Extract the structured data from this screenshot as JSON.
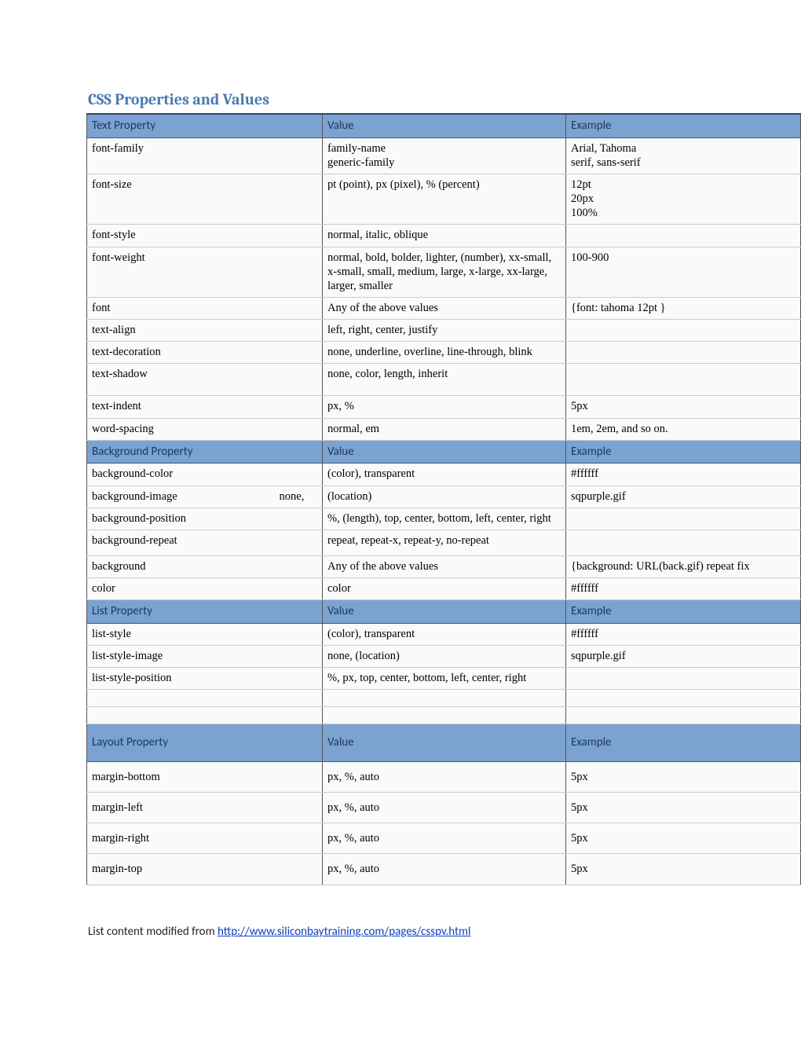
{
  "title": "CSS Properties and Values",
  "columns": {
    "c1": "Text Property",
    "c2": "Value",
    "c3": "Example"
  },
  "section1": {
    "h1": "Text Property",
    "h2": "Value",
    "h3": "Example",
    "rows": [
      {
        "c1": "font-family",
        "c2": "family-name\ngeneric-family",
        "c3": "Arial, Tahoma\nserif, sans-serif"
      },
      {
        "c1": "font-size",
        "c2": "pt (point), px (pixel), % (percent)",
        "c3": "12pt\n20px\n100%"
      },
      {
        "c1": "font-style",
        "c2": "normal, italic, oblique",
        "c3": ""
      },
      {
        "c1": "font-weight",
        "c2": "normal, bold, bolder, lighter, (number), xx-small, x-small, small, medium, large, x-large, xx-large, larger, smaller",
        "c3": "100-900"
      },
      {
        "c1": "font",
        "c2": "Any of the above values",
        "c3": "{font: tahoma 12pt }"
      },
      {
        "c1": "text-align",
        "c2": "left, right, center, justify",
        "c3": ""
      },
      {
        "c1": "text-decoration",
        "c2": "none, underline, overline, line-through, blink",
        "c3": ""
      },
      {
        "c1": "text-shadow",
        "c2": "none, color, length, inherit",
        "c3": ""
      },
      {
        "c1": "text-indent",
        "c2": "px, %",
        "c3": "5px"
      },
      {
        "c1": "word-spacing",
        "c2": "normal, em",
        "c3": "1em, 2em, and so on."
      }
    ]
  },
  "section2": {
    "h1": "Background Property",
    "h2": "Value",
    "h3": "Example",
    "rows": [
      {
        "c1": "background-color",
        "c2": "(color), transparent",
        "c3": "#ffffff"
      },
      {
        "c1_pre": "background-image",
        "c1_none": "none,",
        "c2": "(location)",
        "c3": "sqpurple.gif"
      },
      {
        "c1": "background-position",
        "c2": "%,  (length), top, center, bottom, left, center, right",
        "c3": ""
      },
      {
        "c1": "background-repeat",
        "c2": "repeat, repeat-x, repeat-y, no-repeat",
        "c3": ""
      },
      {
        "c1": "background",
        "c2": "Any of the above values",
        "c3": "{background: URL(back.gif) repeat fix"
      },
      {
        "c1": "color",
        "c2": "color",
        "c3": "#ffffff"
      }
    ]
  },
  "section3": {
    "h1": "List Property",
    "h2": "Value",
    "h3": "Example",
    "rows": [
      {
        "c1": "list-style",
        "c2": "(color), transparent",
        "c3": "#ffffff"
      },
      {
        "c1": "list-style-image",
        "c2": "none, (location)",
        "c3": "sqpurple.gif"
      },
      {
        "c1": "list-style-position",
        "c2": "%, px, top, center, bottom, left, center, right",
        "c3": ""
      }
    ]
  },
  "section4": {
    "h1": "Layout Property",
    "h2": "Value",
    "h3": "Example",
    "rows": [
      {
        "c1": "margin-bottom",
        "c2": "px, %, auto",
        "c3": "5px"
      },
      {
        "c1": "margin-left",
        "c2": "px, %, auto",
        "c3": "5px"
      },
      {
        "c1": "margin-right",
        "c2": "px, %, auto",
        "c3": "5px"
      },
      {
        "c1": "margin-top",
        "c2": "px, %, auto",
        "c3": "5px"
      }
    ]
  },
  "footer": {
    "text": "List content modified from ",
    "url": "http://www.siliconbaytraining.com/pages/csspv.html"
  }
}
